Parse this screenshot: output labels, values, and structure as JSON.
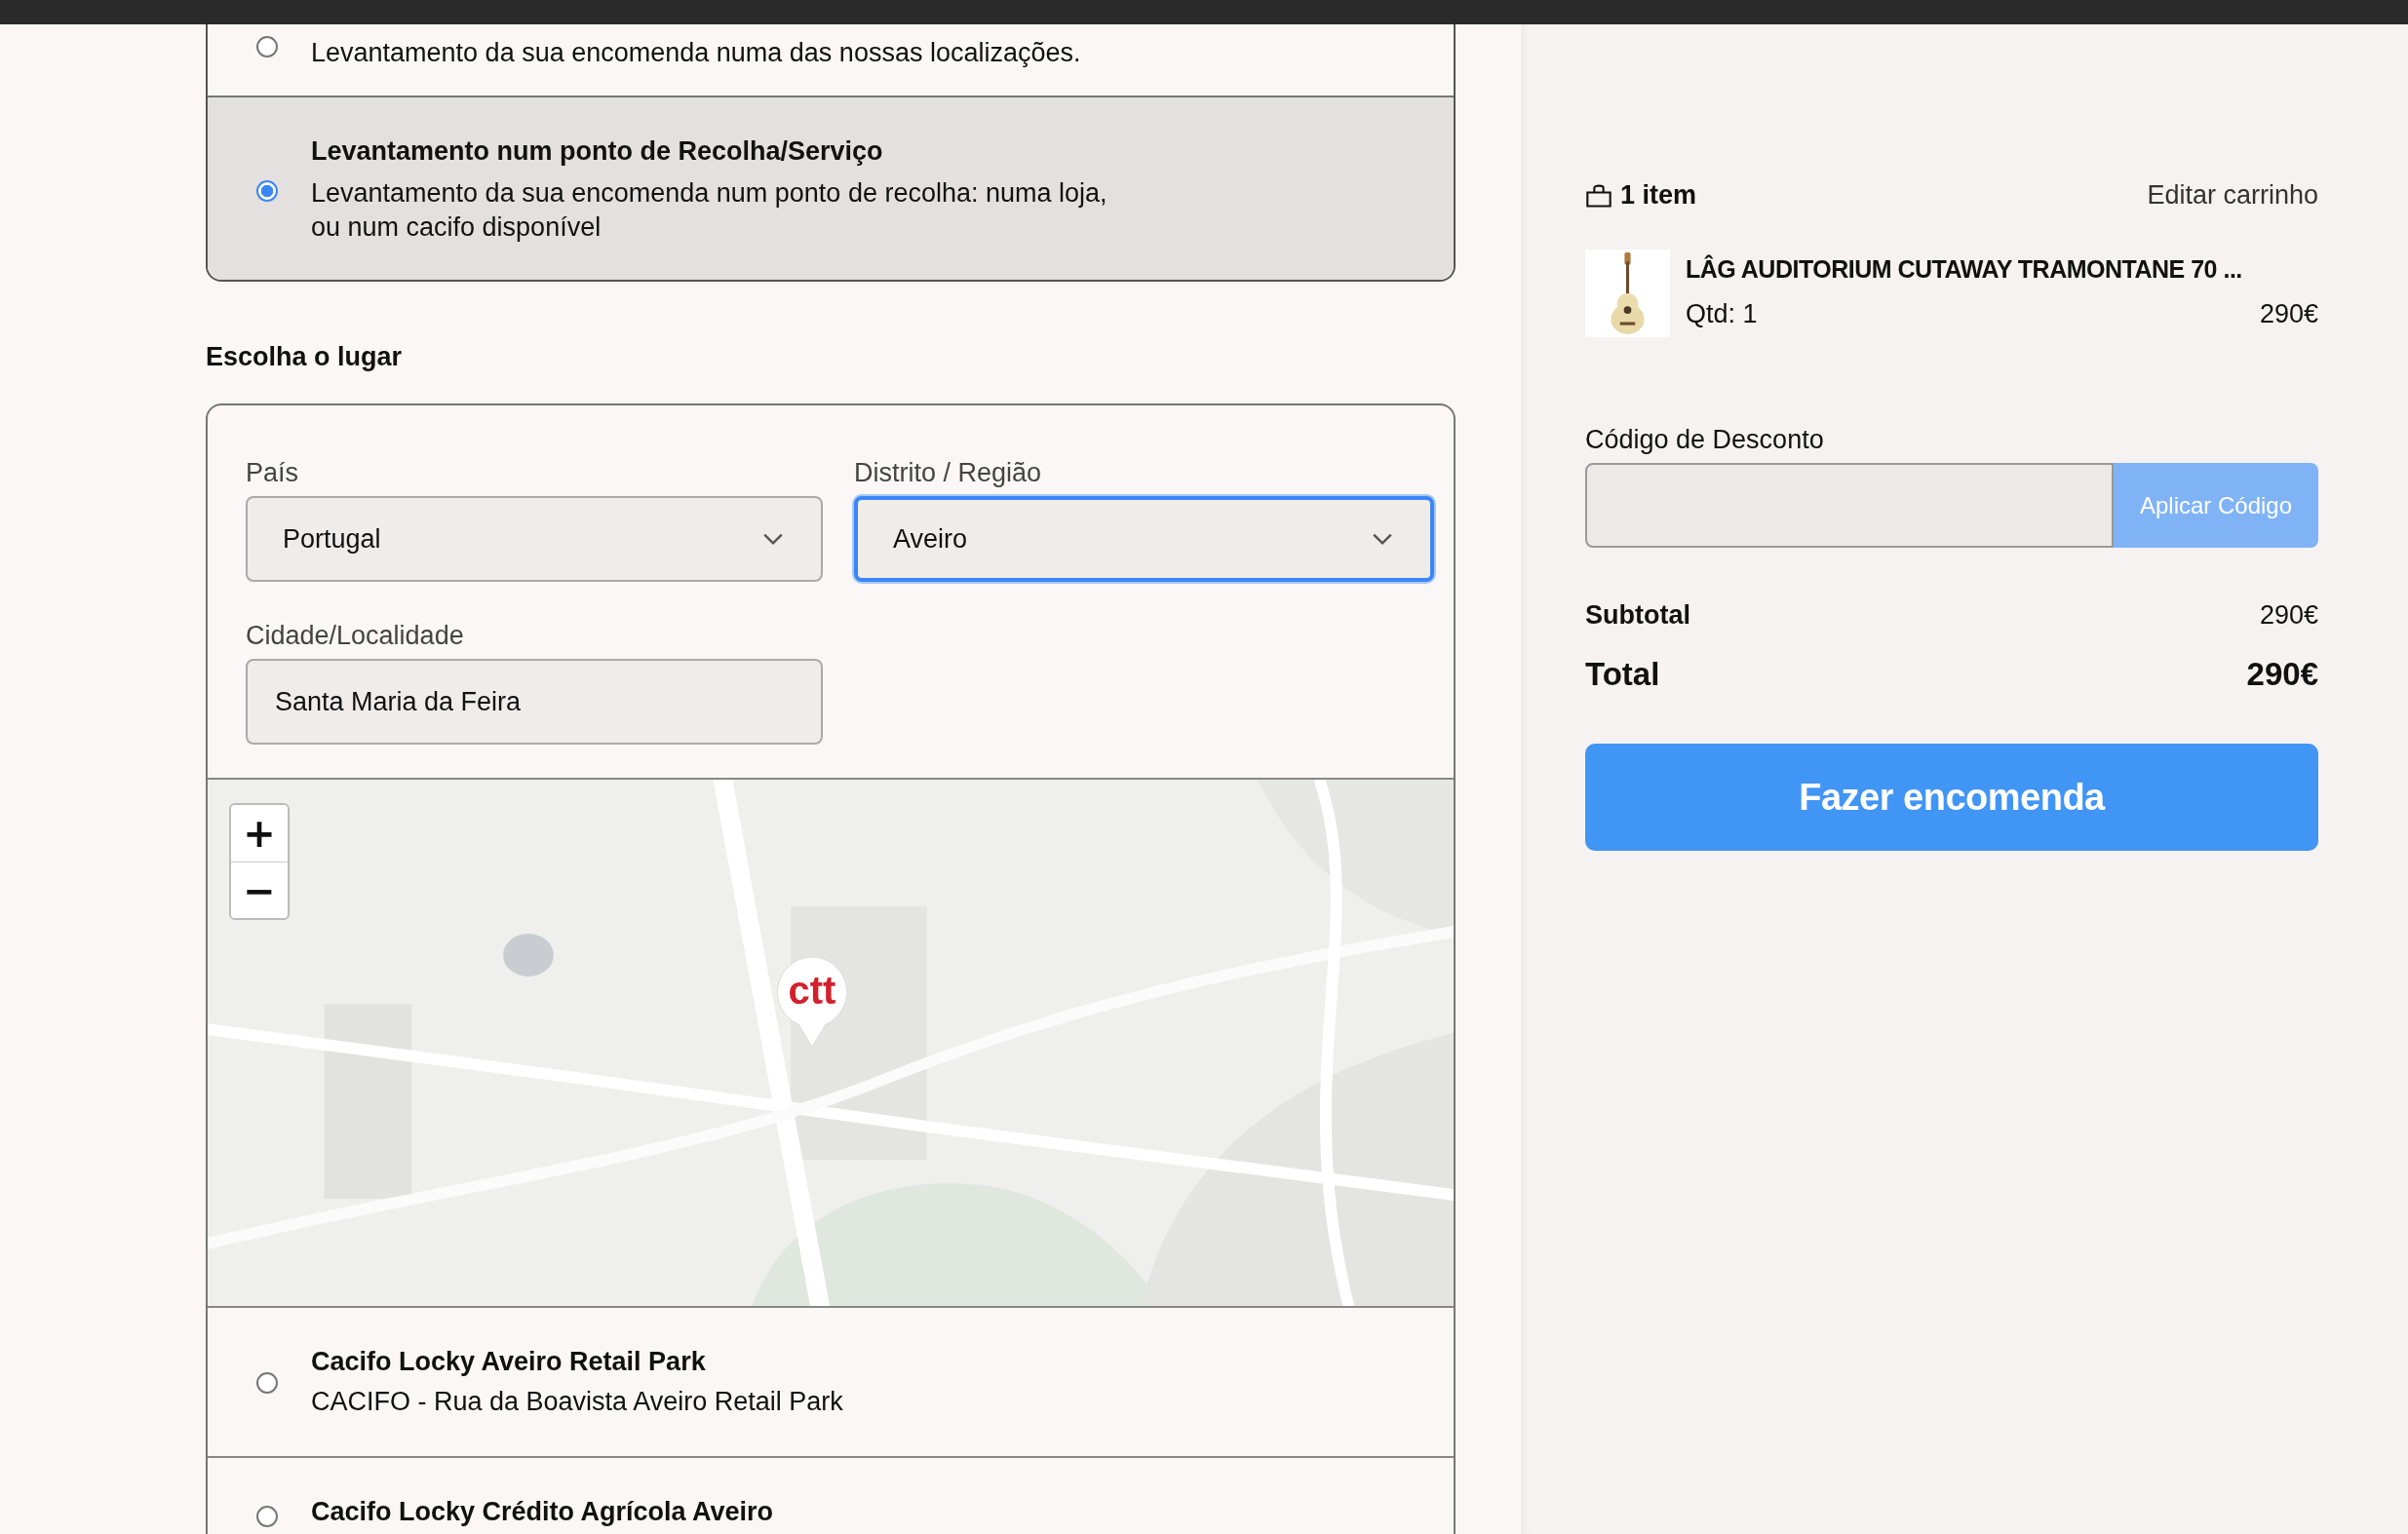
{
  "delivery_options": [
    {
      "description_lines": [
        "Levantamento da sua encomenda numa das nossas localizações."
      ],
      "selected": false
    },
    {
      "title": "Levantamento num ponto de Recolha/Serviço",
      "description_lines": [
        "Levantamento da sua encomenda num ponto de recolha: numa loja,",
        "ou num cacifo disponível"
      ],
      "selected": true
    }
  ],
  "place": {
    "heading": "Escolha o lugar",
    "country": {
      "label": "País",
      "value": "Portugal",
      "focused": false
    },
    "district": {
      "label": "Distrito / Região",
      "value": "Aveiro",
      "focused": true
    },
    "city": {
      "label": "Cidade/Localidade",
      "value": "Santa Maria da Feira"
    },
    "map": {
      "kind": "picture",
      "zoom_in": "+",
      "zoom_out": "−",
      "marker": "ctt"
    },
    "pickup_points": [
      {
        "name": "Cacifo Locky Aveiro Retail Park",
        "address": "CACIFO - Rua da Boavista Aveiro Retail Park",
        "selected": false
      },
      {
        "name": "Cacifo Locky Crédito Agrícola Aveiro",
        "selected": false
      }
    ]
  },
  "cart": {
    "count": "1 item",
    "edit_link": "Editar carrinho",
    "items": [
      {
        "name": "LÂG AUDITORIUM CUTAWAY TRAMONTANE 70 ...",
        "quantity": "Qtd: 1",
        "price": "290€"
      }
    ],
    "discount": {
      "label": "Código de Desconto",
      "button": "Aplicar Código"
    },
    "subtotal": {
      "label": "Subtotal",
      "value": "290€"
    },
    "total": {
      "label": "Total",
      "value": "290€"
    },
    "order_button": "Fazer encomenda"
  }
}
